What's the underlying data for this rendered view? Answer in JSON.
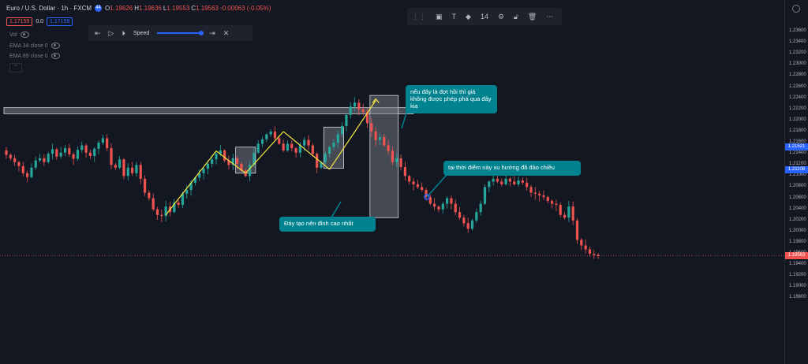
{
  "header": {
    "symbol": "Euro / U.S. Dollar · 1h · FXCM",
    "badge": "44",
    "ohlc": [
      {
        "k": "O",
        "v": "1.19626"
      },
      {
        "k": "H",
        "v": "1.19636"
      },
      {
        "k": "L",
        "v": "1.19553"
      },
      {
        "k": "C",
        "v": "1.19563"
      },
      {
        "k": "",
        "v": "-0.00063 (-0.05%)"
      }
    ],
    "sell_price": "1.17159",
    "spread": "0.0",
    "buy_price": "1.17159"
  },
  "indicators": [
    {
      "label": "Vol"
    },
    {
      "label": "EMA 34 close 0"
    },
    {
      "label": "EMA 89 close 0"
    }
  ],
  "replay": {
    "speed_label": "Speed"
  },
  "drawing_toolbar": {
    "font_size": "14"
  },
  "colors": {
    "bg": "#131722",
    "up": "#26a69a",
    "down": "#ef5350",
    "trend": "#f7e742",
    "callout": "#00838f",
    "zone": "#787b86",
    "axis_text": "#b2b5be",
    "badge_blue": "#2962ff"
  },
  "chart_data": {
    "type": "candlestick",
    "title": "Euro / U.S. Dollar · 1h · FXCM",
    "ylim": [
      1.178,
      1.237
    ],
    "ytick_labels": [
      "1.23600",
      "1.23400",
      "1.23200",
      "1.23000",
      "1.22800",
      "1.22600",
      "1.22400",
      "1.22200",
      "1.22000",
      "1.21800",
      "1.21600",
      "1.21400",
      "1.21200",
      "1.21000",
      "1.20800",
      "1.20600",
      "1.20400",
      "1.20200",
      "1.20000",
      "1.19800",
      "1.19600",
      "1.19400",
      "1.19200",
      "1.19000",
      "1.18800"
    ],
    "ytick_values": [
      1.236,
      1.234,
      1.232,
      1.23,
      1.228,
      1.226,
      1.224,
      1.222,
      1.22,
      1.218,
      1.216,
      1.214,
      1.212,
      1.21,
      1.208,
      1.206,
      1.204,
      1.202,
      1.2,
      1.198,
      1.196,
      1.194,
      1.192,
      1.19,
      1.188
    ],
    "price_labels": [
      {
        "value": 1.21521,
        "text": "1.21521",
        "color": "#2962ff"
      },
      {
        "value": 1.21108,
        "text": "1.21108",
        "color": "#2962ff"
      },
      {
        "value": 1.19563,
        "text": "1.19563",
        "color": "#ef5350"
      }
    ],
    "close_path": [
      1.2138,
      1.2132,
      1.2125,
      1.2118,
      1.2105,
      1.2098,
      1.2115,
      1.2128,
      1.2132,
      1.2125,
      1.214,
      1.2148,
      1.2135,
      1.2142,
      1.215,
      1.2139,
      1.2131,
      1.2147,
      1.2155,
      1.2142,
      1.2136,
      1.2149,
      1.216,
      1.2168,
      1.215,
      1.212,
      1.2115,
      1.213,
      1.21,
      1.2115,
      1.2105,
      1.212,
      1.2095,
      1.207,
      1.206,
      1.204,
      1.203,
      1.2028,
      1.2045,
      1.2035,
      1.2052,
      1.2048,
      1.2068,
      1.2075,
      1.2088,
      1.2097,
      1.2105,
      1.2113,
      1.2122,
      1.213,
      1.214,
      1.2146,
      1.2128,
      1.212,
      1.2132,
      1.2122,
      1.211,
      1.21,
      1.212,
      1.2142,
      1.2158,
      1.2166,
      1.2175,
      1.218,
      1.2168,
      1.2158,
      1.2146,
      1.2158,
      1.215,
      1.2142,
      1.2155,
      1.2165,
      1.2155,
      1.214,
      1.2115,
      1.2125,
      1.214,
      1.2152,
      1.216,
      1.2175,
      1.219,
      1.221,
      1.2225,
      1.2232,
      1.222,
      1.2215,
      1.2195,
      1.218,
      1.2165,
      1.217,
      1.2155,
      1.2145,
      1.2125,
      1.2132,
      1.2116,
      1.21,
      1.209,
      1.2085,
      1.208,
      1.2075,
      1.2062,
      1.205,
      1.2045,
      1.204,
      1.205,
      1.206,
      1.205,
      1.2035,
      1.2025,
      1.2015,
      1.2005,
      1.202,
      1.2035,
      1.205,
      1.208,
      1.209,
      1.2095,
      1.209,
      1.2085,
      1.2095,
      1.209,
      1.2085,
      1.2092,
      1.2088,
      1.208,
      1.207,
      1.2068,
      1.2065,
      1.2062,
      1.2055,
      1.205,
      1.2048,
      1.203,
      1.2025,
      1.2045,
      1.202,
      1.1985,
      1.1975,
      1.1968,
      1.196,
      1.1958,
      1.1956
    ],
    "trend_lines": [
      {
        "from": [
          38,
          1.203
        ],
        "to": [
          50,
          1.2145
        ]
      },
      {
        "from": [
          50,
          1.2145
        ],
        "to": [
          57,
          1.2105
        ]
      },
      {
        "from": [
          57,
          1.2105
        ],
        "to": [
          66,
          1.218
        ]
      },
      {
        "from": [
          66,
          1.218
        ],
        "to": [
          77,
          1.2112
        ]
      },
      {
        "from": [
          77,
          1.2112
        ],
        "to": [
          88,
          1.2236
        ]
      }
    ],
    "resistance_zone": {
      "from_index": 0,
      "to_index": 97,
      "y_top": 1.2223,
      "y_bottom": 1.2212
    },
    "boxes": [
      {
        "from_index": 55,
        "to_index": 59,
        "y_top": 1.2152,
        "y_bottom": 1.2105
      },
      {
        "from_index": 76,
        "to_index": 80,
        "y_top": 1.2188,
        "y_bottom": 1.2114
      },
      {
        "from_index": 87,
        "to_index": 93,
        "y_top": 1.2245,
        "y_bottom": 1.2025
      }
    ],
    "annotations": [
      {
        "text": "nếu đây là đợt hồi thì giá không được phép phá qua đây kia"
      },
      {
        "text": "tại thời điểm này xu hướng đã đảo chiều"
      },
      {
        "text": "Đáy tạo nên đỉnh cao nhất"
      }
    ]
  }
}
